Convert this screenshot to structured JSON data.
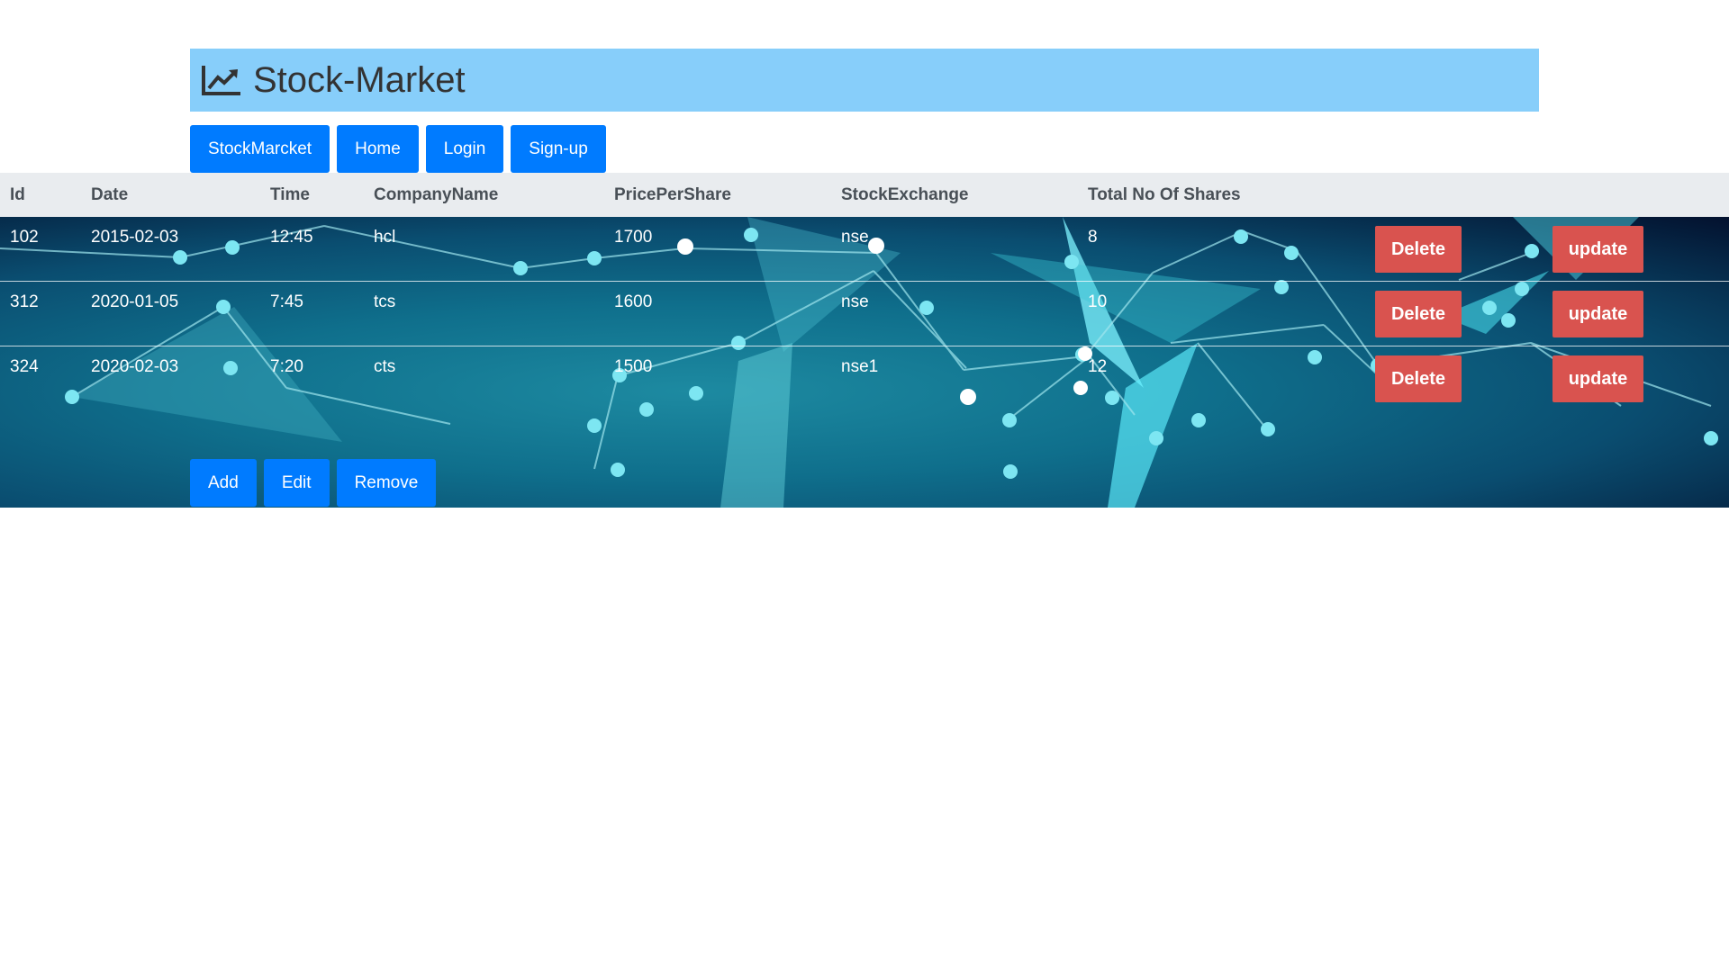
{
  "header": {
    "title": "Stock-Market",
    "icon": "chart-line-icon",
    "background": "#87cefa"
  },
  "nav": {
    "items": [
      {
        "label": "StockMarcket"
      },
      {
        "label": "Home"
      },
      {
        "label": "Login"
      },
      {
        "label": "Sign-up"
      }
    ]
  },
  "table": {
    "columns": [
      "Id",
      "Date",
      "Time",
      "CompanyName",
      "PricePerShare",
      "StockExchange",
      "Total No Of Shares"
    ],
    "rows": [
      {
        "id": "102",
        "date": "2015-02-03",
        "time": "12:45",
        "company": "hcl",
        "price": "1700",
        "exchange": "nse",
        "shares": "8",
        "delete_label": "Delete",
        "update_label": "update"
      },
      {
        "id": "312",
        "date": "2020-01-05",
        "time": "7:45",
        "company": "tcs",
        "price": "1600",
        "exchange": "nse",
        "shares": "10",
        "delete_label": "Delete",
        "update_label": "update"
      },
      {
        "id": "324",
        "date": "2020-02-03",
        "time": "7:20",
        "company": "cts",
        "price": "1500",
        "exchange": "nse1",
        "shares": "12",
        "delete_label": "Delete",
        "update_label": "update"
      }
    ]
  },
  "actions": {
    "add_label": "Add",
    "edit_label": "Edit",
    "remove_label": "Remove"
  },
  "colors": {
    "primary_button": "#007bff",
    "danger_button": "#d9534f",
    "table_header": "#e9ecef"
  }
}
